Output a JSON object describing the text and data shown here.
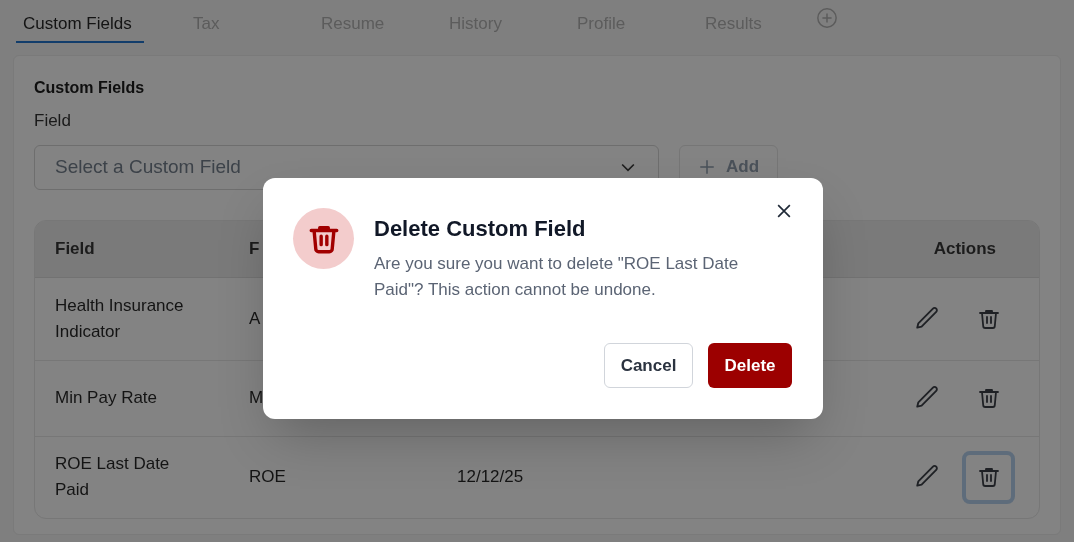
{
  "tabs": [
    {
      "label": "Custom Fields",
      "selected": true
    },
    {
      "label": "Tax",
      "selected": false
    },
    {
      "label": "Resume",
      "selected": false
    },
    {
      "label": "History",
      "selected": false
    },
    {
      "label": "Profile",
      "selected": false
    },
    {
      "label": "Results",
      "selected": false
    }
  ],
  "section": {
    "title": "Custom Fields",
    "field_label": "Field",
    "select": {
      "placeholder": "Select a Custom Field"
    },
    "add_button": "Add"
  },
  "table": {
    "columns": [
      "Field",
      "F"
    ],
    "actions_header": "Actions",
    "rows": [
      {
        "cells": [
          "Health Insurance Indicator",
          "A"
        ],
        "delete_focused": false
      },
      {
        "cells": [
          "Min Pay Rate",
          "M"
        ],
        "delete_focused": false
      },
      {
        "cells": [
          "ROE Last Date Paid",
          "ROE",
          "12/12/25"
        ],
        "delete_focused": true
      }
    ]
  },
  "dialog": {
    "title": "Delete Custom Field",
    "message": "Are you sure you want to delete \"ROE Last Date Paid\"? This action cannot be undone.",
    "cancel_button": "Cancel",
    "confirm_button": "Delete"
  }
}
